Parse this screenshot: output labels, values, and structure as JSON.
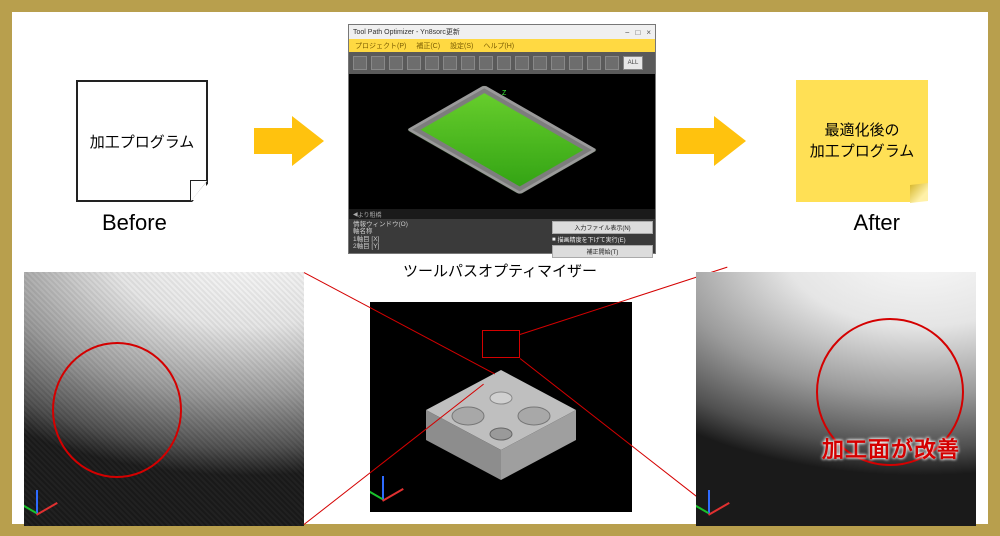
{
  "before": {
    "note": "加工プログラム",
    "caption": "Before"
  },
  "after": {
    "note_line1": "最適化後の",
    "note_line2": "加工プログラム",
    "caption": "After"
  },
  "app": {
    "title": "Tool Path Optimizer - Yn8sorc更新",
    "menus": {
      "project": "プロジェクト(P)",
      "correct": "補正(C)",
      "settings": "設定(S)",
      "help": "ヘルプ(H)"
    },
    "slider_label": "より粗橋",
    "info_title": "情報ウィンドウ(O)",
    "info_lines": {
      "a": "軸名称",
      "b": "1軸目 [X]",
      "c": "2軸目 [Y]"
    },
    "buttons": {
      "show_input": "入力ファイル表示(N)",
      "low_precision": "描画精度を下げて実行(E)",
      "start": "補正開始(T)"
    },
    "toolbar_all": "ALL",
    "caption": "ツールパスオプティマイザー"
  },
  "improvement_label": "加工面が改善",
  "icons": {
    "arrow": "arrow-right-icon",
    "min": "−",
    "max": "□",
    "close": "×"
  }
}
